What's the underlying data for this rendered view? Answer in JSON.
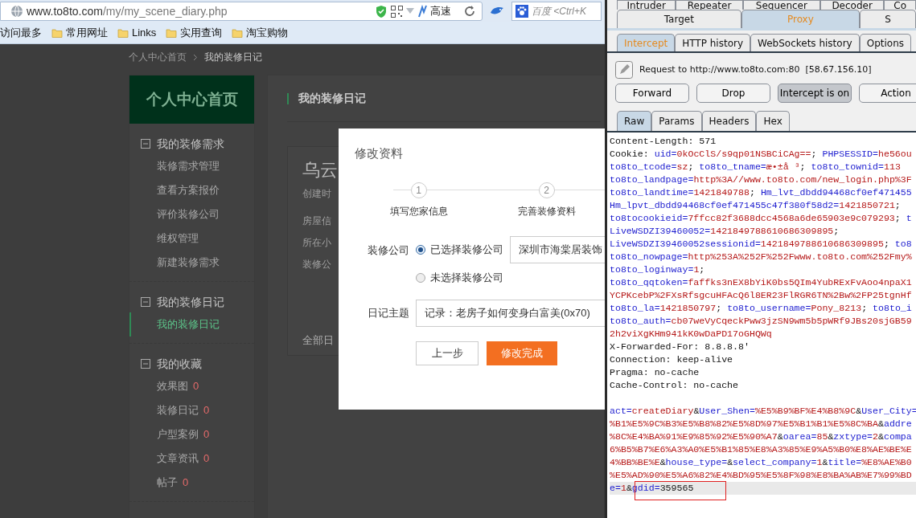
{
  "browser": {
    "url": {
      "host": "www.to8to.com",
      "path": "/my/my_scene_diary.php"
    },
    "speed_label": "高速",
    "search_placeholder": "百度 <Ctrl+K",
    "bookmarks": [
      {
        "label": "访问最多",
        "kind": "text"
      },
      {
        "label": "常用网址",
        "kind": "folder"
      },
      {
        "label": "Links",
        "kind": "folder"
      },
      {
        "label": "实用查询",
        "kind": "folder"
      },
      {
        "label": "淘宝购物",
        "kind": "folder"
      }
    ]
  },
  "page": {
    "breadcrumb": [
      "个人中心首页",
      "我的装修日记"
    ],
    "sidebar": {
      "header": "个人中心首页",
      "groups": [
        {
          "title": "我的装修需求",
          "expanded": true,
          "items": [
            {
              "label": "装修需求管理",
              "selected": false
            },
            {
              "label": "查看方案报价",
              "selected": false
            },
            {
              "label": "评价装修公司",
              "selected": false
            },
            {
              "label": "维权管理",
              "selected": false
            },
            {
              "label": "新建装修需求",
              "selected": false
            }
          ]
        },
        {
          "title": "我的装修日记",
          "expanded": true,
          "items": [
            {
              "label": "我的装修日记",
              "selected": true
            }
          ]
        },
        {
          "title": "我的收藏",
          "expanded": true,
          "items": [
            {
              "label": "效果图",
              "count": "0",
              "selected": false
            },
            {
              "label": "装修日记",
              "count": "0",
              "selected": false
            },
            {
              "label": "户型案例",
              "count": "0",
              "selected": false
            },
            {
              "label": "文章资讯",
              "count": "0",
              "selected": false
            },
            {
              "label": "帖子",
              "count": "0",
              "selected": false
            }
          ]
        }
      ]
    },
    "main": {
      "heading": "我的装修日记",
      "card_title": "乌云",
      "card_meta": "创建时",
      "details": [
        "房屋信",
        "所在小",
        "装修公"
      ],
      "footer": "全部日"
    }
  },
  "dialog": {
    "title": "修改资料",
    "steps": [
      {
        "number": "1",
        "label": "填写您家信息"
      },
      {
        "number": "2",
        "label": "完善装修资料"
      }
    ],
    "company": {
      "label": "装修公司",
      "options": [
        {
          "label": "已选择装修公司",
          "selected": true
        },
        {
          "label": "未选择装修公司",
          "selected": false
        }
      ],
      "value": "深圳市海棠居装饰"
    },
    "topic": {
      "label": "日记主题",
      "value": "记录：老房子如何变身白富美(0x70)"
    },
    "buttons": [
      {
        "label": "上一步",
        "kind": "secondary"
      },
      {
        "label": "修改完成",
        "kind": "primary"
      }
    ]
  },
  "burp": {
    "tool_tabs": [
      [
        {
          "label": "Intruder",
          "selected": false
        },
        {
          "label": "Repeater",
          "selected": false
        },
        {
          "label": "Sequencer",
          "selected": false
        },
        {
          "label": "Decoder",
          "selected": false
        },
        {
          "label": "Co",
          "selected": false
        }
      ],
      [
        {
          "label": "Target",
          "selected": false
        },
        {
          "label": "Proxy",
          "selected": true
        },
        {
          "label": "S",
          "selected": false
        }
      ]
    ],
    "proxy_tabs": [
      {
        "label": "Intercept",
        "selected": true
      },
      {
        "label": "HTTP history",
        "selected": false
      },
      {
        "label": "WebSockets history",
        "selected": false
      },
      {
        "label": "Options",
        "selected": false
      }
    ],
    "request_label": "Request to http://www.to8to.com:80  [58.67.156.10]",
    "actions": [
      {
        "label": "Forward",
        "pressed": false
      },
      {
        "label": "Drop",
        "pressed": false
      },
      {
        "label": "Intercept is on",
        "pressed": true
      },
      {
        "label": "Action",
        "pressed": false
      }
    ],
    "view_tabs": [
      {
        "label": "Raw",
        "selected": true
      },
      {
        "label": "Params",
        "selected": false
      },
      {
        "label": "Headers",
        "selected": false
      },
      {
        "label": "Hex",
        "selected": false
      }
    ],
    "headers": [
      [
        {
          "kind": "t",
          "text": "Content-Length: 571"
        }
      ],
      [
        {
          "kind": "t",
          "text": "Cookie: "
        },
        {
          "kind": "k",
          "text": "uid="
        },
        {
          "kind": "v",
          "text": "0kOcClS/s9qp01NSBCiCAg=="
        },
        {
          "kind": "t",
          "text": "; "
        },
        {
          "kind": "k",
          "text": "PHPSESSID="
        },
        {
          "kind": "v",
          "text": "he56ou"
        }
      ],
      [
        {
          "kind": "k",
          "text": "to8to_tcode="
        },
        {
          "kind": "v",
          "text": "sz"
        },
        {
          "kind": "t",
          "text": "; "
        },
        {
          "kind": "k",
          "text": "to8to_tname="
        },
        {
          "kind": "v",
          "text": "æ•±å ³"
        },
        {
          "kind": "t",
          "text": "; "
        },
        {
          "kind": "k",
          "text": "to8to_townid="
        },
        {
          "kind": "v",
          "text": "113"
        }
      ],
      [
        {
          "kind": "k",
          "text": "to8to_landpage="
        },
        {
          "kind": "v",
          "text": "http%3A//www.to8to.com/new_login.php%3F"
        }
      ],
      [
        {
          "kind": "k",
          "text": "to8to_landtime="
        },
        {
          "kind": "v",
          "text": "1421849788"
        },
        {
          "kind": "t",
          "text": "; "
        },
        {
          "kind": "k",
          "text": "Hm_lvt_dbdd94468cf0ef471455"
        }
      ],
      [
        {
          "kind": "k",
          "text": "Hm_lpvt_dbdd94468cf0ef471455c47f380f58d2="
        },
        {
          "kind": "v",
          "text": "1421850721"
        },
        {
          "kind": "t",
          "text": ";"
        }
      ],
      [
        {
          "kind": "k",
          "text": "to8tocookieid="
        },
        {
          "kind": "v",
          "text": "7ffcc82f3688dcc4568a6de65903e9c079293"
        },
        {
          "kind": "t",
          "text": "; "
        },
        {
          "kind": "k",
          "text": "t"
        }
      ],
      [
        {
          "kind": "k",
          "text": "LiveWSDZI39460052="
        },
        {
          "kind": "v",
          "text": "1421849788610686309895"
        },
        {
          "kind": "t",
          "text": ";"
        }
      ],
      [
        {
          "kind": "k",
          "text": "LiveWSDZI39460052sessionid="
        },
        {
          "kind": "v",
          "text": "1421849788610686309895"
        },
        {
          "kind": "t",
          "text": "; "
        },
        {
          "kind": "k",
          "text": "to8"
        }
      ],
      [
        {
          "kind": "k",
          "text": "to8to_nowpage="
        },
        {
          "kind": "v",
          "text": "http%253A%252F%252Fwww.to8to.com%252Fmy%"
        }
      ],
      [
        {
          "kind": "k",
          "text": "to8to_loginway="
        },
        {
          "kind": "v",
          "text": "1"
        },
        {
          "kind": "t",
          "text": ";"
        }
      ],
      [
        {
          "kind": "k",
          "text": "to8to_qqtoken="
        },
        {
          "kind": "v",
          "text": "faffks3nEX8bYiK0bs5QIm4YubRExFvAoo4npaX1"
        }
      ],
      [
        {
          "kind": "v",
          "text": "YCPKcebP%2FXsRfsgcuHFAcQ6l8ER23FlRGR6TN%2Bw%2FP25tgnHf"
        }
      ],
      [
        {
          "kind": "k",
          "text": "to8to_la="
        },
        {
          "kind": "v",
          "text": "1421850797"
        },
        {
          "kind": "t",
          "text": "; "
        },
        {
          "kind": "k",
          "text": "to8to_username="
        },
        {
          "kind": "v",
          "text": "Pony_8213"
        },
        {
          "kind": "t",
          "text": "; "
        },
        {
          "kind": "k",
          "text": "to8to_i"
        }
      ],
      [
        {
          "kind": "k",
          "text": "to8to_auth="
        },
        {
          "kind": "v",
          "text": "cb07weVyCqeckPww3jzSN9wm5b5pWRf9JBs20sjGB59"
        }
      ],
      [
        {
          "kind": "v",
          "text": "2h2viXgKHm941kK0wDaPD17oGHQWq"
        }
      ],
      [
        {
          "kind": "t",
          "text": "X-Forwarded-For: 8.8.8.8'"
        }
      ],
      [
        {
          "kind": "t",
          "text": "Connection: keep-alive"
        }
      ],
      [
        {
          "kind": "t",
          "text": "Pragma: no-cache"
        }
      ],
      [
        {
          "kind": "t",
          "text": "Cache-Control: no-cache"
        }
      ]
    ],
    "body": [
      {
        "highlighted": false,
        "boxed": false,
        "tokens": [
          {
            "kind": "k",
            "text": "act="
          },
          {
            "kind": "v",
            "text": "createDiary"
          },
          {
            "kind": "t",
            "text": "&"
          },
          {
            "kind": "k",
            "text": "User_Shen="
          },
          {
            "kind": "v",
            "text": "%E5%B9%BF%E4%B8%9C"
          },
          {
            "kind": "t",
            "text": "&"
          },
          {
            "kind": "k",
            "text": "User_City="
          }
        ]
      },
      {
        "highlighted": false,
        "boxed": false,
        "tokens": [
          {
            "kind": "v",
            "text": "%B1%E5%9C%B3%E5%B8%82%E5%8D%97%E5%B1%B1%E5%8C%BA"
          },
          {
            "kind": "t",
            "text": "&"
          },
          {
            "kind": "k",
            "text": "addre"
          }
        ]
      },
      {
        "highlighted": false,
        "boxed": false,
        "tokens": [
          {
            "kind": "v",
            "text": "%8C%E4%BA%91%E9%85%92%E5%90%A7"
          },
          {
            "kind": "t",
            "text": "&"
          },
          {
            "kind": "k",
            "text": "oarea="
          },
          {
            "kind": "v",
            "text": "85"
          },
          {
            "kind": "t",
            "text": "&"
          },
          {
            "kind": "k",
            "text": "zxtype="
          },
          {
            "kind": "v",
            "text": "2"
          },
          {
            "kind": "t",
            "text": "&"
          },
          {
            "kind": "k",
            "text": "compa"
          }
        ]
      },
      {
        "highlighted": false,
        "boxed": false,
        "tokens": [
          {
            "kind": "v",
            "text": "6%B5%B7%E6%A3%A0%E5%B1%85%E8%A3%85%E9%A5%B0%E8%AE%BE%E"
          }
        ]
      },
      {
        "highlighted": false,
        "boxed": false,
        "tokens": [
          {
            "kind": "v",
            "text": "4%BB%BE%E"
          },
          {
            "kind": "t",
            "text": "&"
          },
          {
            "kind": "k",
            "text": "house_type="
          },
          {
            "kind": "t",
            "text": "&"
          },
          {
            "kind": "k",
            "text": "select_company="
          },
          {
            "kind": "v",
            "text": "1"
          },
          {
            "kind": "t",
            "text": "&"
          },
          {
            "kind": "k",
            "text": "title="
          },
          {
            "kind": "v",
            "text": "%E8%AE%B0"
          }
        ]
      },
      {
        "highlighted": false,
        "boxed": false,
        "tokens": [
          {
            "kind": "v",
            "text": "%E5%AD%90%E5%A6%82%E4%BD%95%E5%8F%98%E8%BA%AB%E7%99%BD"
          }
        ]
      },
      {
        "highlighted": true,
        "boxed": true,
        "tokens": [
          {
            "kind": "k",
            "text": "e="
          },
          {
            "kind": "v",
            "text": "1"
          },
          {
            "kind": "t",
            "text": "&"
          },
          {
            "kind": "k",
            "text": "gdid="
          },
          {
            "kind": "t",
            "text": "359565"
          }
        ]
      }
    ]
  }
}
